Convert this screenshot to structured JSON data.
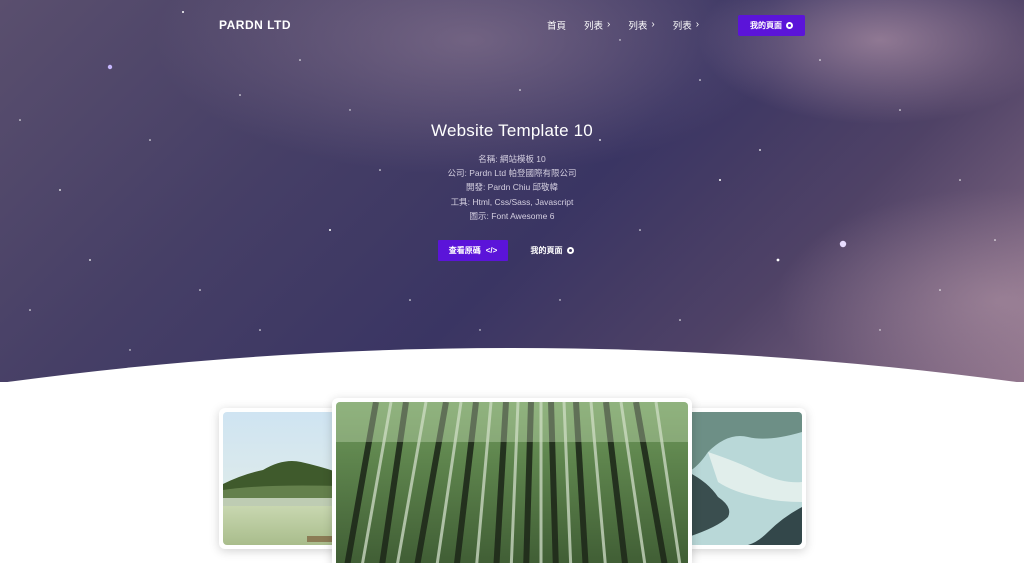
{
  "brand": "PARDN LTD",
  "nav": {
    "home": "首頁",
    "list1": "列表",
    "list2": "列表",
    "list3": "列表",
    "my_page": "我的頁面"
  },
  "hero": {
    "title": "Website Template 10",
    "info": [
      "名稱: 網站模板 10",
      "公司: Pardn Ltd 帕登國際有限公司",
      "開發: Pardn Chiu 邱敬幃",
      "工具: Html, Css/Sass, Javascript",
      "圖示: Font Awesome 6"
    ],
    "view_source_label": "查看原碼",
    "my_page_label": "我的頁面"
  },
  "gallery": {
    "images": [
      "lake-hills-photo",
      "bamboo-forest-photo",
      "river-canyon-photo"
    ]
  },
  "colors": {
    "accent": "#5b14d9",
    "hero_dark": "#3a3563",
    "hero_light": "#8c7189"
  },
  "icons": {
    "chevron": "chevron-right-icon",
    "code": "code-icon",
    "github": "github-icon"
  }
}
